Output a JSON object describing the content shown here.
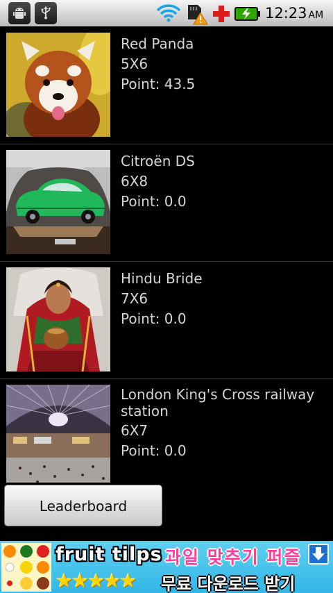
{
  "status_bar": {
    "time": "12:23",
    "ampm": "AM",
    "icons": [
      "android-icon",
      "usb-icon",
      "wifi-icon",
      "sd-card-warning-icon",
      "medical-cross-icon",
      "battery-charging-icon"
    ]
  },
  "puzzles": [
    {
      "title": "Red Panda",
      "size": "5X6",
      "points": "Point: 43.5",
      "image": "red-panda-photo"
    },
    {
      "title": "Citroën DS",
      "size": "6X8",
      "points": "Point: 0.0",
      "image": "citroen-ds-photo"
    },
    {
      "title": "Hindu Bride",
      "size": "7X6",
      "points": "Point: 0.0",
      "image": "hindu-bride-photo"
    },
    {
      "title": "London King's Cross railway station",
      "size": "6X7",
      "points": "Point: 0.0",
      "image": "kings-cross-photo"
    }
  ],
  "leaderboard_label": "Leaderboard",
  "ad": {
    "title": "fruit tilps",
    "korean_top": "과일 맞추기 퍼즐",
    "stars": "★★★★★",
    "korean_bottom": "무료 다운로드 받기",
    "accent": "#33b6e6"
  }
}
